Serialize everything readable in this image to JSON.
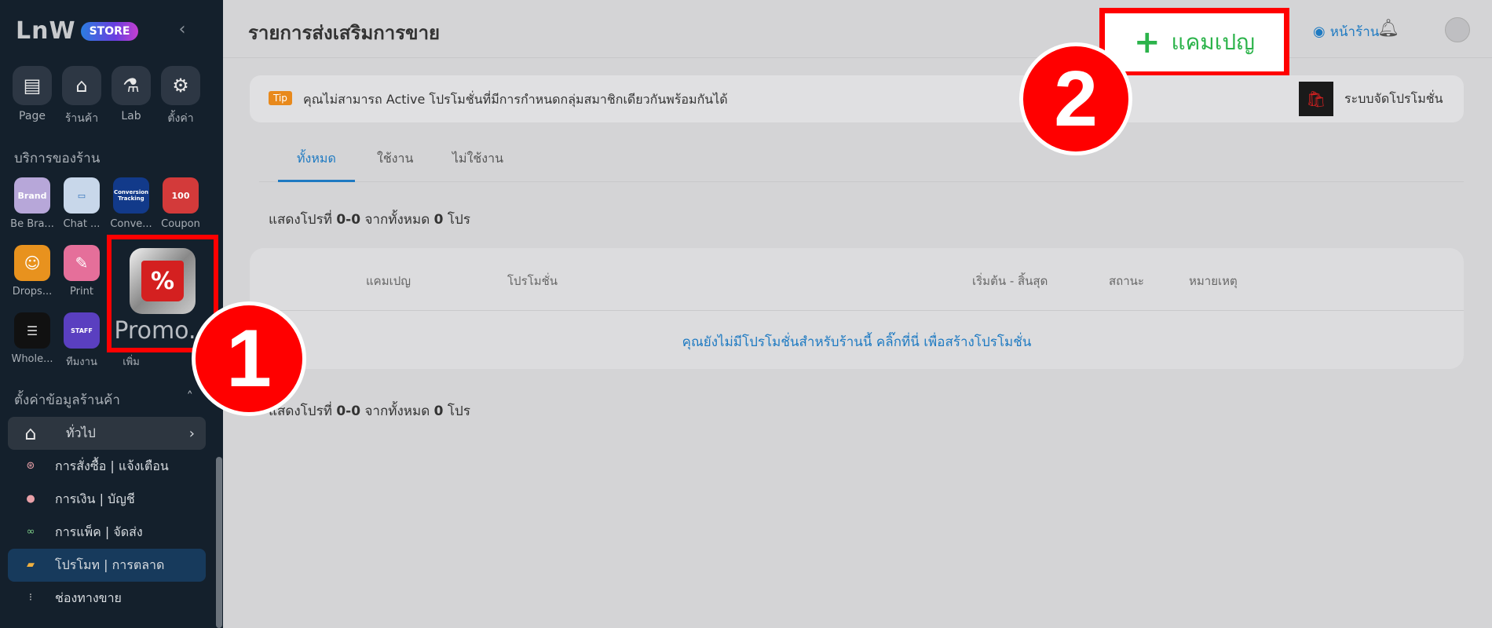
{
  "sidebar": {
    "logo_text": "LnW",
    "logo_badge": "STORE",
    "top_icons": [
      {
        "icon": "page-icon",
        "label": "Page"
      },
      {
        "icon": "store-icon",
        "label": "ร้านค้า"
      },
      {
        "icon": "lab-flask-icon",
        "label": "Lab"
      },
      {
        "icon": "gear-icon",
        "label": "ตั้งค่า"
      }
    ],
    "services_title": "บริการของร้าน",
    "apps": [
      {
        "icon": "be-brand-icon",
        "label": "Be Bra...",
        "icon_text": "Brand",
        "color": "#b7a7d9"
      },
      {
        "icon": "chat-icon",
        "label": "Chat ...",
        "icon_text": "",
        "color": "#c8d7ea"
      },
      {
        "icon": "conversion-tracking-icon",
        "label": "Conve...",
        "icon_text": "Conversion Tracking",
        "color": "#123a8a"
      },
      {
        "icon": "coupon-icon",
        "label": "Coupon",
        "icon_text": "100",
        "color": "#d33a3a"
      },
      {
        "icon": "dropship-icon",
        "label": "Drops...",
        "icon_text": "",
        "color": "#e8921e"
      },
      {
        "icon": "print-icon",
        "label": "Print",
        "icon_text": "",
        "color": "#e56f9a"
      },
      {
        "icon": "wholesale-icon",
        "label": "Whole...",
        "icon_text": "",
        "color": "#111111"
      },
      {
        "icon": "staff-icon",
        "label": "ทีมงาน",
        "icon_text": "STAFF",
        "color": "#5a3fc0"
      },
      {
        "icon": "add-more-icon",
        "label": "เพิ่ม",
        "icon_text": "",
        "color": "#14202c"
      }
    ],
    "promo_app": {
      "label": "Promo...",
      "icon_text": "%"
    },
    "settings_title": "ตั้งค่าข้อมูลร้านค้า",
    "nav_items": [
      {
        "label": "ทั่วไป",
        "icon": "store-front-icon"
      },
      {
        "label": "การสั่งซื้อ | แจ้งเตือน",
        "icon": "order-icon"
      },
      {
        "label": "การเงิน | บัญชี",
        "icon": "piggy-bank-icon"
      },
      {
        "label": "การแพ็ค | จัดส่ง",
        "icon": "bicycle-icon"
      },
      {
        "label": "โปรโมท | การตลาด",
        "icon": "ticket-icon"
      },
      {
        "label": "ช่องทางขาย",
        "icon": "channel-icon"
      }
    ]
  },
  "header": {
    "title": "รายการส่งเสริมการขาย",
    "campaign_button": "แคมเปญ",
    "storefront_link": "หน้าร้าน"
  },
  "tip": {
    "badge": "Tip",
    "text": "คุณไม่สามารถ Active โปรโมชั่นที่มีการกำหนดกลุ่มสมาชิกเดียวกันพร้อมกันได้",
    "promo_system_label": "ระบบจัดโปรโมชั่น"
  },
  "tabs": [
    "ทั้งหมด",
    "ใช้งาน",
    "ไม่ใช้งาน"
  ],
  "count": {
    "prefix": "แสดงโปรที่",
    "range": "0-0",
    "middle": "จากทั้งหมด",
    "total": "0",
    "suffix": "โปร"
  },
  "table": {
    "headers": [
      "แคมเปญ",
      "โปรโมชั่น",
      "เริ่มต้น - สิ้นสุด",
      "สถานะ",
      "หมายเหตุ"
    ],
    "empty_message": "คุณยังไม่มีโปรโมชั่นสำหรับร้านนี้ คลิ๊กที่นี่ เพื่อสร้างโปรโมชั่น"
  },
  "steps": [
    "1",
    "2"
  ],
  "colors": {
    "accent": "#1e7ac2",
    "highlight": "#ff0000",
    "campaign_green": "#2bb34a",
    "sidebar_bg": "#14202c"
  }
}
